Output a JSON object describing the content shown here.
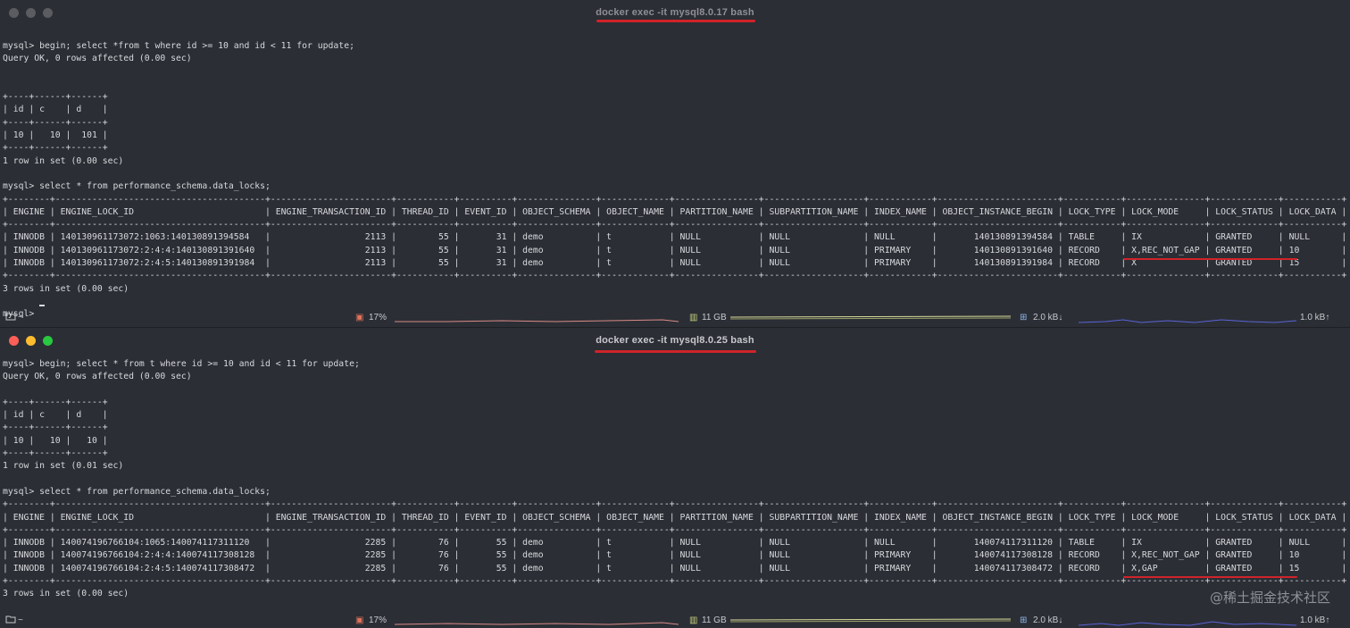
{
  "window_top": {
    "title": "docker exec -it mysql8.0.17 bash",
    "terminal": "mysql> begin; select *from t where id >= 10 and id < 11 for update;\nQuery OK, 0 rows affected (0.00 sec)\n\n\n+----+------+------+\n| id | c    | d    |\n+----+------+------+\n| 10 |   10 |  101 |\n+----+------+------+\n1 row in set (0.00 sec)\n\nmysql> select * from performance_schema.data_locks;\n+--------+----------------------------------------+-----------------------+-----------+----------+---------------+-------------+----------------+-------------------+------------+-----------------------+-----------+---------------+-------------+-----------+\n| ENGINE | ENGINE_LOCK_ID                         | ENGINE_TRANSACTION_ID | THREAD_ID | EVENT_ID | OBJECT_SCHEMA | OBJECT_NAME | PARTITION_NAME | SUBPARTITION_NAME | INDEX_NAME | OBJECT_INSTANCE_BEGIN | LOCK_TYPE | LOCK_MODE     | LOCK_STATUS | LOCK_DATA |\n+--------+----------------------------------------+-----------------------+-----------+----------+---------------+-------------+----------------+-------------------+------------+-----------------------+-----------+---------------+-------------+-----------+\n| INNODB | 140130961173072:1063:140130891394584   |                  2113 |        55 |       31 | demo          | t           | NULL           | NULL              | NULL       |       140130891394584 | TABLE     | IX            | GRANTED     | NULL      |\n| INNODB | 140130961173072:2:4:4:140130891391640  |                  2113 |        55 |       31 | demo          | t           | NULL           | NULL              | PRIMARY    |       140130891391640 | RECORD    | X,REC_NOT_GAP | GRANTED     | 10        |\n| INNODB | 140130961173072:2:4:5:140130891391984  |                  2113 |        55 |       31 | demo          | t           | NULL           | NULL              | PRIMARY    |       140130891391984 | RECORD    | X             | GRANTED     | 15        |\n+--------+----------------------------------------+-----------------------+-----------+----------+---------------+-------------+----------------+-------------------+------------+-----------------------+-----------+---------------+-------------+-----------+\n3 rows in set (0.00 sec)\n\nmysql> ",
    "status": {
      "cwd": "~",
      "cpu": "17%",
      "mem": "11 GB",
      "net_down": "2.0 kB↓",
      "net_up": "1.0 kB↑"
    }
  },
  "window_bottom": {
    "title": "docker exec -it mysql8.0.25 bash",
    "terminal": "mysql> begin; select * from t where id >= 10 and id < 11 for update;\nQuery OK, 0 rows affected (0.00 sec)\n\n+----+------+------+\n| id | c    | d    |\n+----+------+------+\n| 10 |   10 |   10 |\n+----+------+------+\n1 row in set (0.01 sec)\n\nmysql> select * from performance_schema.data_locks;\n+--------+----------------------------------------+-----------------------+-----------+----------+---------------+-------------+----------------+-------------------+------------+-----------------------+-----------+---------------+-------------+-----------+\n| ENGINE | ENGINE_LOCK_ID                         | ENGINE_TRANSACTION_ID | THREAD_ID | EVENT_ID | OBJECT_SCHEMA | OBJECT_NAME | PARTITION_NAME | SUBPARTITION_NAME | INDEX_NAME | OBJECT_INSTANCE_BEGIN | LOCK_TYPE | LOCK_MODE     | LOCK_STATUS | LOCK_DATA |\n+--------+----------------------------------------+-----------------------+-----------+----------+---------------+-------------+----------------+-------------------+------------+-----------------------+-----------+---------------+-------------+-----------+\n| INNODB | 140074196766104:1065:140074117311120   |                  2285 |        76 |       55 | demo          | t           | NULL           | NULL              | NULL       |       140074117311120 | TABLE     | IX            | GRANTED     | NULL      |\n| INNODB | 140074196766104:2:4:4:140074117308128  |                  2285 |        76 |       55 | demo          | t           | NULL           | NULL              | PRIMARY    |       140074117308128 | RECORD    | X,REC_NOT_GAP | GRANTED     | 10        |\n| INNODB | 140074196766104:2:4:5:140074117308472  |                  2285 |        76 |       55 | demo          | t           | NULL           | NULL              | PRIMARY    |       140074117308472 | RECORD    | X,GAP         | GRANTED     | 15        |\n+--------+----------------------------------------+-----------------------+-----------+----------+---------------+-------------+----------------+-------------------+------------+-----------------------+-----------+---------------+-------------+-----------+\n3 rows in set (0.00 sec)",
    "status": {
      "cwd": "~",
      "cpu": "17%",
      "mem": "11 GB",
      "net_down": "2.0 kB↓",
      "net_up": "1.0 kB↑"
    }
  },
  "watermark": "@稀土掘金技术社区",
  "colors": {
    "background": "#2b2e35",
    "text": "#d7d9dc",
    "annotation_red": "#d0232a",
    "light_close": "#fe5f57",
    "light_minimize": "#febc2e",
    "light_zoom": "#28c840"
  },
  "icons": [
    "folder-icon",
    "cpu-icon",
    "memory-icon",
    "network-icon"
  ]
}
